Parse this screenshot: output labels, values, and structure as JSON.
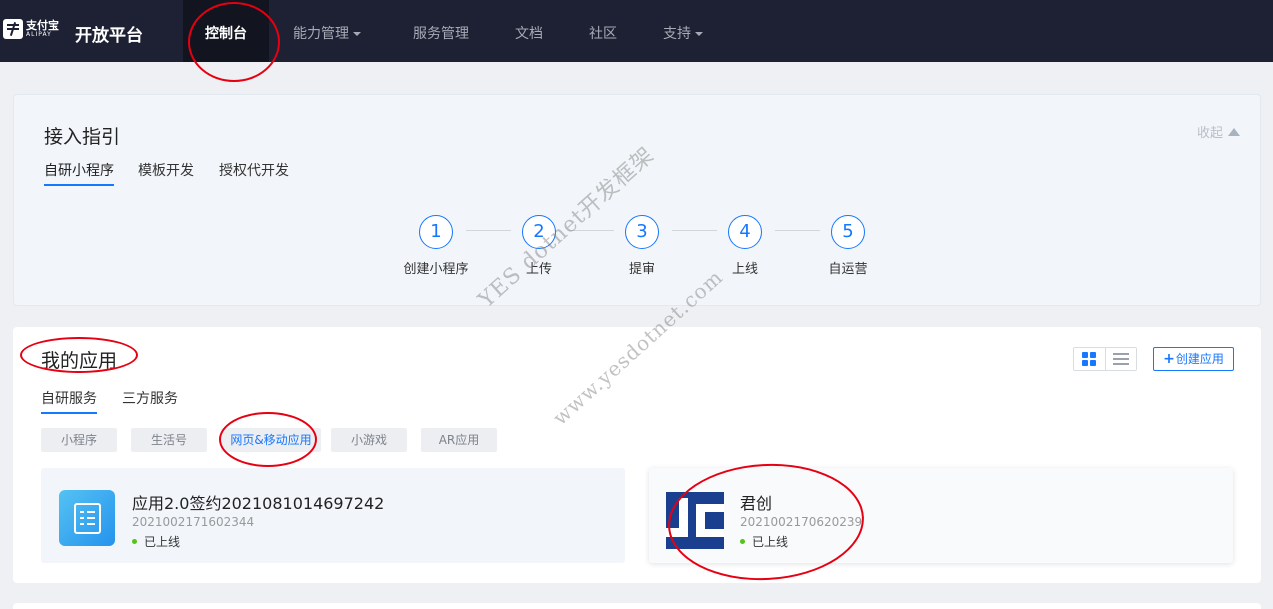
{
  "brand": {
    "logo_cn": "支付宝",
    "logo_en": "ALIPAY",
    "title": "开放平台"
  },
  "nav": {
    "items": [
      {
        "label": "控制台",
        "active": true
      },
      {
        "label": "能力管理",
        "dropdown": true
      },
      {
        "label": "服务管理"
      },
      {
        "label": "文档"
      },
      {
        "label": "社区"
      },
      {
        "label": "支持",
        "dropdown": true
      }
    ]
  },
  "guide": {
    "title": "接入指引",
    "collapse_label": "收起",
    "tabs": [
      {
        "label": "自研小程序",
        "active": true
      },
      {
        "label": "模板开发"
      },
      {
        "label": "授权代开发"
      }
    ],
    "steps": [
      {
        "num": "1",
        "label": "创建小程序"
      },
      {
        "num": "2",
        "label": "上传"
      },
      {
        "num": "3",
        "label": "提审"
      },
      {
        "num": "4",
        "label": "上线"
      },
      {
        "num": "5",
        "label": "自运营"
      }
    ]
  },
  "apps": {
    "title": "我的应用",
    "create_label": "创建应用",
    "tabs": [
      {
        "label": "自研服务",
        "active": true
      },
      {
        "label": "三方服务"
      }
    ],
    "filters": [
      {
        "label": "小程序"
      },
      {
        "label": "生活号"
      },
      {
        "label": "网页&移动应用",
        "active": true
      },
      {
        "label": "小游戏"
      },
      {
        "label": "AR应用"
      }
    ],
    "cards": [
      {
        "name": "应用2.0签约2021081014697242",
        "id": "2021002171602344",
        "status": "已上线"
      },
      {
        "name": "君创",
        "id": "2021002170620239",
        "status": "已上线"
      }
    ]
  },
  "watermark": {
    "line1": "YES dotnet开发框架",
    "line2": "www.yesdotnet.com"
  },
  "colors": {
    "topbar": "#1e2133",
    "accent": "#1677ff",
    "annotation": "#e60012",
    "online": "#52c41a"
  }
}
